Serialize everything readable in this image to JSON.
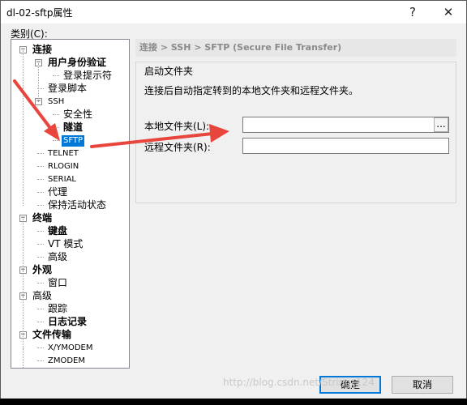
{
  "window": {
    "title": "dl-02-sftp属性",
    "help_glyph": "?",
    "close_glyph": "✕"
  },
  "category_label": "类别(C):",
  "tree": [
    {
      "label": "连接",
      "bold": true,
      "expander": "−"
    },
    {
      "label": "用户身份验证",
      "bold": true,
      "expander": "−"
    },
    {
      "label": "登录提示符",
      "bold": false
    },
    {
      "label": "登录脚本",
      "bold": false
    },
    {
      "label": "SSH",
      "bold": false,
      "small": true,
      "expander": "−"
    },
    {
      "label": "安全性",
      "bold": false
    },
    {
      "label": "隧道",
      "bold": true
    },
    {
      "label": "SFTP",
      "bold": false,
      "small": true,
      "selected": true
    },
    {
      "label": "TELNET",
      "bold": false,
      "small": true
    },
    {
      "label": "RLOGIN",
      "bold": false,
      "small": true
    },
    {
      "label": "SERIAL",
      "bold": false,
      "small": true
    },
    {
      "label": "代理",
      "bold": false
    },
    {
      "label": "保持活动状态",
      "bold": false
    },
    {
      "label": "终端",
      "bold": true,
      "expander": "−"
    },
    {
      "label": "键盘",
      "bold": true
    },
    {
      "label": "VT 模式",
      "bold": false
    },
    {
      "label": "高级",
      "bold": false
    },
    {
      "label": "外观",
      "bold": true,
      "expander": "−"
    },
    {
      "label": "窗口",
      "bold": false
    },
    {
      "label": "高级",
      "bold": false,
      "expander": "−"
    },
    {
      "label": "跟踪",
      "bold": false
    },
    {
      "label": "日志记录",
      "bold": true
    },
    {
      "label": "文件传输",
      "bold": true,
      "expander": "−"
    },
    {
      "label": "X/YMODEM",
      "bold": false,
      "small": true
    },
    {
      "label": "ZMODEM",
      "bold": false,
      "small": true
    }
  ],
  "main": {
    "breadcrumb": "连接 > SSH > SFTP (Secure File Transfer)",
    "group_title": "启动文件夹",
    "group_desc": "连接后自动指定转到的本地文件夹和远程文件夹。",
    "local_label": "本地文件夹(L):",
    "local_value": "",
    "local_browse": "...",
    "remote_label": "远程文件夹(R):",
    "remote_value": ""
  },
  "buttons": {
    "ok": "确定",
    "cancel": "取消"
  },
  "watermark": "http://blog.csdn.net/String_124",
  "colors": {
    "selection": "#0078d7",
    "annotation_arrow": "#e8453c"
  }
}
